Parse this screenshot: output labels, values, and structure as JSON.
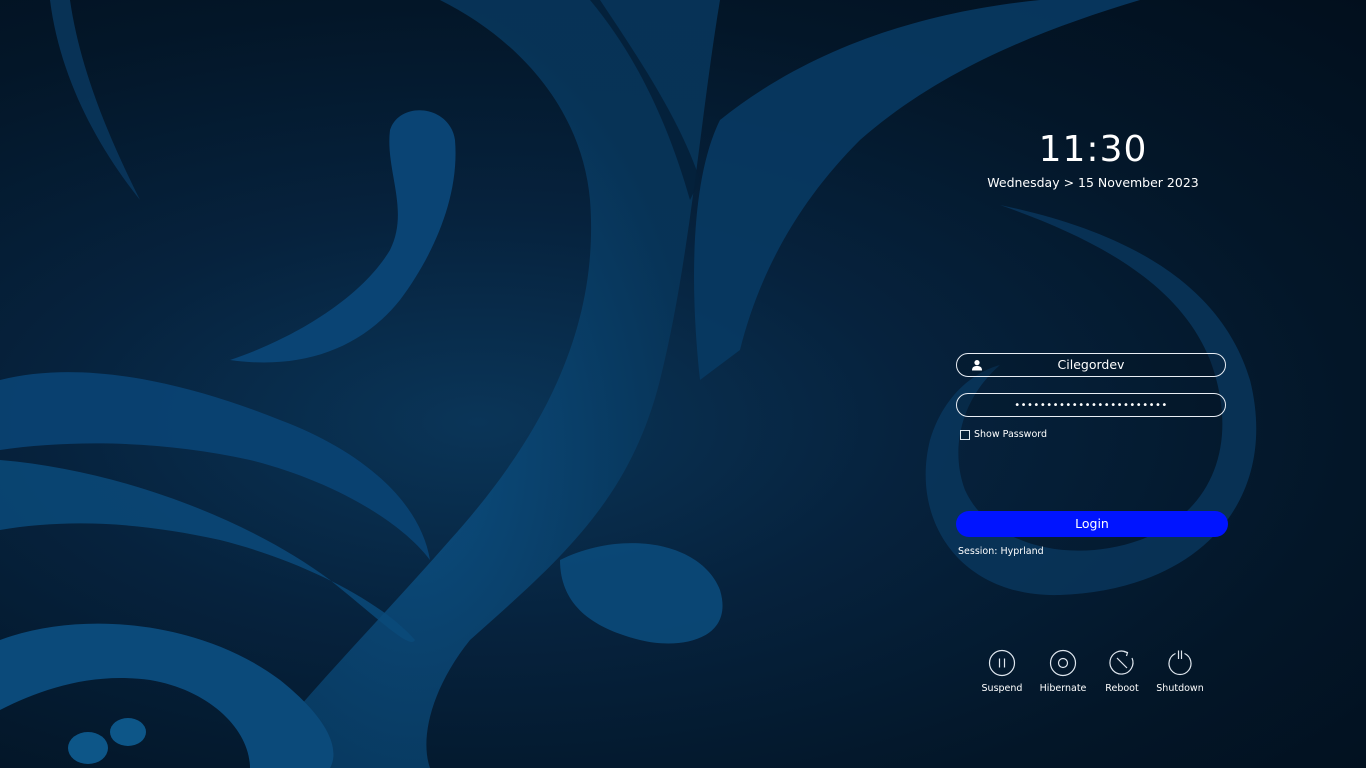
{
  "clock": {
    "time": "11:30",
    "date": "Wednesday > 15 November 2023"
  },
  "login_form": {
    "username": "Cilegordev",
    "password_masked": "••••••••••••••••••••••••",
    "show_password_label": "Show Password",
    "show_password_checked": false,
    "login_label": "Login",
    "session_text": "Session: Hyprland"
  },
  "power": {
    "suspend_label": "Suspend",
    "hibernate_label": "Hibernate",
    "reboot_label": "Reboot",
    "shutdown_label": "Shutdown"
  },
  "colors": {
    "accent": "#0014ff",
    "background_dark": "#031628",
    "wallpaper_swirl": "#0b4a7a"
  }
}
